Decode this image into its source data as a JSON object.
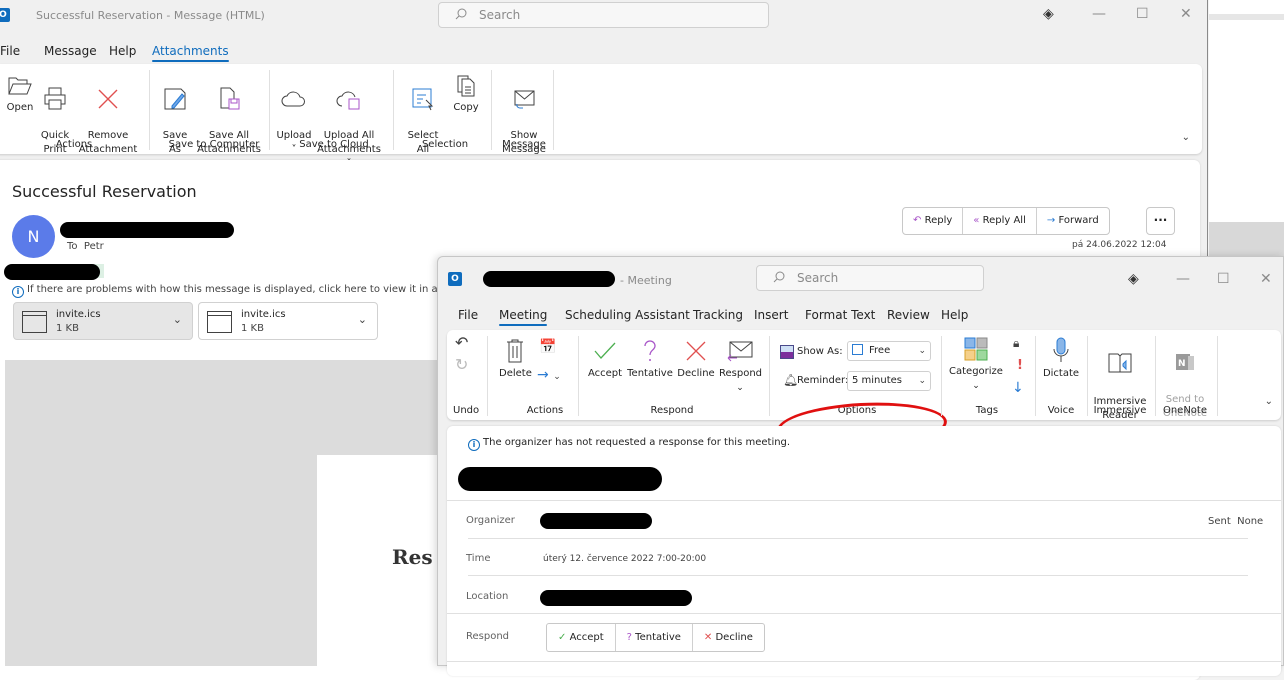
{
  "main_window": {
    "title": "Successful Reservation  -  Message (HTML)",
    "search_placeholder": "Search",
    "menu": [
      "File",
      "Message",
      "Help",
      "Attachments"
    ],
    "active_menu": "Attachments",
    "ribbon": {
      "groups": [
        {
          "label": "Actions",
          "buttons": [
            {
              "label": "Open",
              "icon": "folder-open-icon"
            },
            {
              "label": "Quick\nPrint",
              "icon": "printer-icon"
            },
            {
              "label": "Remove\nAttachment",
              "icon": "remove-x-icon"
            }
          ]
        },
        {
          "label": "Save to Computer",
          "buttons": [
            {
              "label": "Save\nAs",
              "icon": "save-as-icon"
            },
            {
              "label": "Save All\nAttachments",
              "icon": "save-all-icon"
            }
          ]
        },
        {
          "label": "Save to Cloud",
          "buttons": [
            {
              "label": "Upload\n˅",
              "icon": "cloud-icon"
            },
            {
              "label": "Upload All\nAttachments ˅",
              "icon": "cloud-save-icon"
            }
          ]
        },
        {
          "label": "Selection",
          "buttons": [
            {
              "label": "Select\nAll",
              "icon": "select-all-icon"
            },
            {
              "label": "Copy",
              "icon": "copy-icon"
            }
          ]
        },
        {
          "label": "Message",
          "buttons": [
            {
              "label": "Show\nMessage",
              "icon": "envelope-icon"
            }
          ]
        }
      ]
    },
    "message": {
      "subject": "Successful Reservation",
      "avatar_initial": "N",
      "avatar_color": "#5b7be9",
      "to_label": "To",
      "to_name": "Petr",
      "info_text": "If there are problems with how this message is displayed, click here to view it in a web b",
      "attachments": [
        {
          "name": "invite.ics",
          "size": "1 KB"
        },
        {
          "name": "invite.ics",
          "size": "1 KB"
        }
      ],
      "actions": {
        "reply": "Reply",
        "reply_all": "Reply All",
        "forward": "Forward",
        "more": "···"
      },
      "date": "pá 24.06.2022 12:04",
      "body_heading_partial": "Res"
    }
  },
  "meeting_window": {
    "title_suffix": "- Meeting",
    "search_placeholder": "Search",
    "menu": [
      "File",
      "Meeting",
      "Scheduling Assistant",
      "Tracking",
      "Insert",
      "Format Text",
      "Review",
      "Help"
    ],
    "active_menu": "Meeting",
    "ribbon": {
      "undo_label": "Undo",
      "actions_label": "Actions",
      "delete_label": "Delete",
      "respond_label": "Respond",
      "respond_buttons": [
        "Accept",
        "Tentative",
        "Decline",
        "Respond"
      ],
      "options_label": "Options",
      "show_as_label": "Show As:",
      "show_as_value": "Free",
      "reminder_label": "Reminder:",
      "reminder_value": "5 minutes",
      "tags_label": "Tags",
      "categorize_label": "Categorize",
      "voice_label": "Voice",
      "dictate_label": "Dictate",
      "immersive_label": "Immersive",
      "immersive_reader_label": "Immersive\nReader",
      "onenote_label": "OneNote",
      "send_onenote_label": "Send to\nOneNote"
    },
    "info_text": "The organizer has not requested a response for this meeting.",
    "fields": {
      "organizer_label": "Organizer",
      "time_label": "Time",
      "time_value": "úterý 12. července 2022 7:00-20:00",
      "location_label": "Location",
      "respond_label": "Respond",
      "sent_label": "Sent",
      "sent_value": "None"
    },
    "respond_buttons": {
      "accept": "Accept",
      "tentative": "Tentative",
      "decline": "Decline"
    }
  },
  "colors": {
    "accent": "#0f6cbd",
    "annotation": "#e01010"
  }
}
